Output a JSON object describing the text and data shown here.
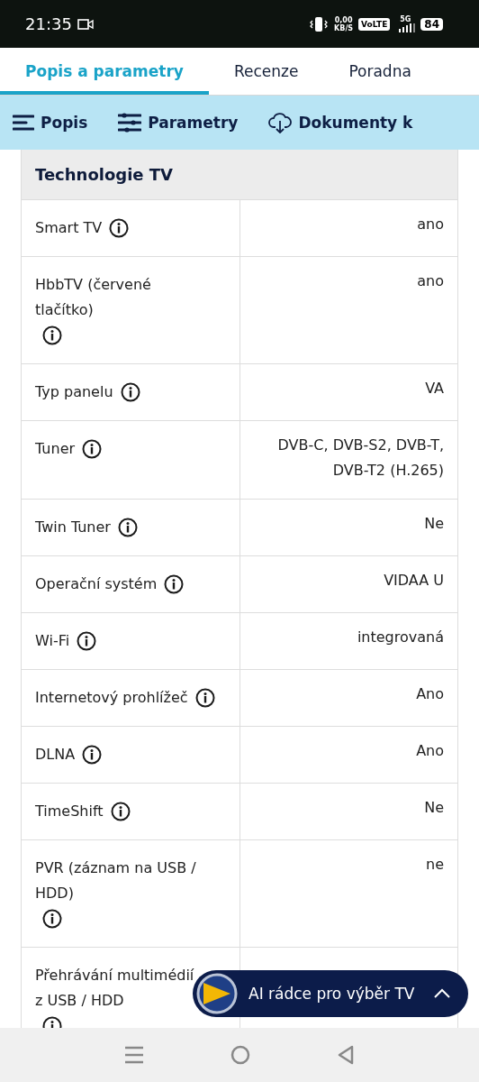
{
  "status_bar": {
    "time": "21:35",
    "net_speed": "0,00",
    "net_unit": "KB/S",
    "volte": "VoLTE",
    "network": "5G",
    "battery": "84"
  },
  "tabs": [
    {
      "label": "Popis a parametry",
      "selected": true
    },
    {
      "label": "Recenze",
      "selected": false
    },
    {
      "label": "Poradna",
      "selected": false
    }
  ],
  "section_nav": [
    {
      "label": "Popis"
    },
    {
      "label": "Parametry"
    },
    {
      "label": "Dokumenty k"
    }
  ],
  "table": {
    "heading": "Technologie TV",
    "rows": [
      {
        "name": "Smart TV",
        "value": "ano"
      },
      {
        "name": "HbbTV (červené tlačítko)",
        "value": "ano"
      },
      {
        "name": "Typ panelu",
        "value": "VA"
      },
      {
        "name": "Tuner",
        "value": "DVB-C, DVB-S2, DVB-T, DVB-T2 (H.265)"
      },
      {
        "name": "Twin Tuner",
        "value": "Ne"
      },
      {
        "name": "Operační systém",
        "value": "VIDAA U"
      },
      {
        "name": "Wi-Fi",
        "value": "integrovaná"
      },
      {
        "name": "Internetový prohlížeč",
        "value": "Ano"
      },
      {
        "name": "DLNA",
        "value": "Ano"
      },
      {
        "name": "TimeShift",
        "value": "Ne"
      },
      {
        "name": "PVR (záznam na USB / HDD)",
        "value": "ne"
      },
      {
        "name": "Přehrávání multimédií z USB / HDD"
      }
    ]
  },
  "assistant_button": {
    "label": "AI rádce pro výběr TV",
    "expanded": false
  }
}
